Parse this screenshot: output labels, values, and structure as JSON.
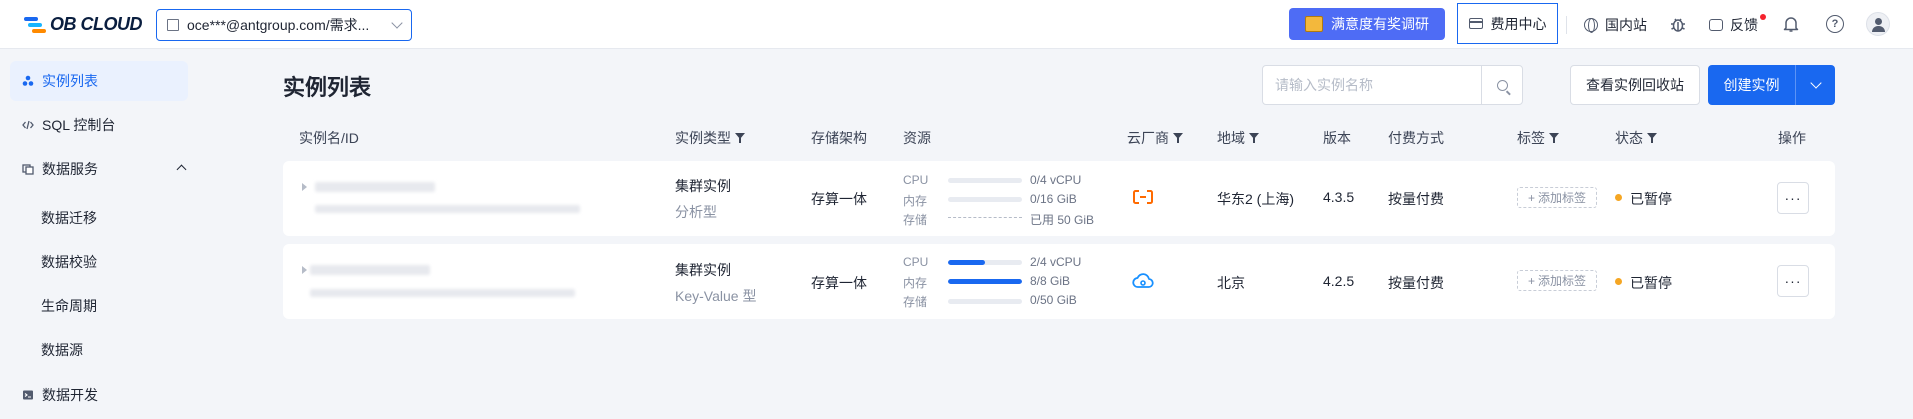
{
  "header": {
    "logo_text": "OB CLOUD",
    "org_selector_value": "oce***@antgroup.com/需求...",
    "survey_button": "满意度有奖调研",
    "cost_center": "费用中心",
    "region": "国内站",
    "feedback": "反馈"
  },
  "sidebar": {
    "items": [
      {
        "label": "实例列表",
        "active": true
      },
      {
        "label": "SQL 控制台"
      },
      {
        "label": "数据服务",
        "expanded": true
      },
      {
        "label": "数据开发"
      }
    ],
    "data_service_children": [
      "数据迁移",
      "数据校验",
      "生命周期",
      "数据源"
    ]
  },
  "main": {
    "title": "实例列表",
    "search_placeholder": "请输入实例名称",
    "recycle_button": "查看实例回收站",
    "create_button": "创建实例",
    "columns": {
      "name": "实例名/ID",
      "type": "实例类型",
      "storage_arch": "存储架构",
      "resource": "资源",
      "cloud": "云厂商",
      "region": "地域",
      "version": "版本",
      "billing": "付费方式",
      "tags": "标签",
      "status": "状态",
      "actions": "操作"
    },
    "resource_labels": {
      "cpu": "CPU",
      "memory": "内存",
      "storage": "存储"
    },
    "rows": [
      {
        "type": "集群实例",
        "subtype": "分析型",
        "storage_arch": "存算一体",
        "cpu": "0/4 vCPU",
        "cpu_fraction": 0,
        "memory": "0/16 GiB",
        "memory_fraction": 0,
        "storage": "已用 50 GiB",
        "cloud": "aliyun-icon",
        "region": "华东2 (上海)",
        "version": "4.3.5",
        "billing": "按量付费",
        "tag_add": "添加标签",
        "status": "已暂停",
        "more": "···"
      },
      {
        "type": "集群实例",
        "subtype": "Key-Value 型",
        "storage_arch": "存算一体",
        "cpu": "2/4 vCPU",
        "cpu_fraction": 0.5,
        "memory": "8/8 GiB",
        "memory_fraction": 1,
        "storage": "0/50 GiB",
        "cloud": "cloud-icon",
        "region": "北京",
        "version": "4.2.5",
        "billing": "按量付费",
        "tag_add": "添加标签",
        "status": "已暂停",
        "more": "···"
      }
    ]
  },
  "colors": {
    "primary": "#1968f0",
    "survey": "#4e6cf5",
    "paused": "#f5a623",
    "aliyun": "#ff6a00",
    "cloud": "#1890ff"
  }
}
